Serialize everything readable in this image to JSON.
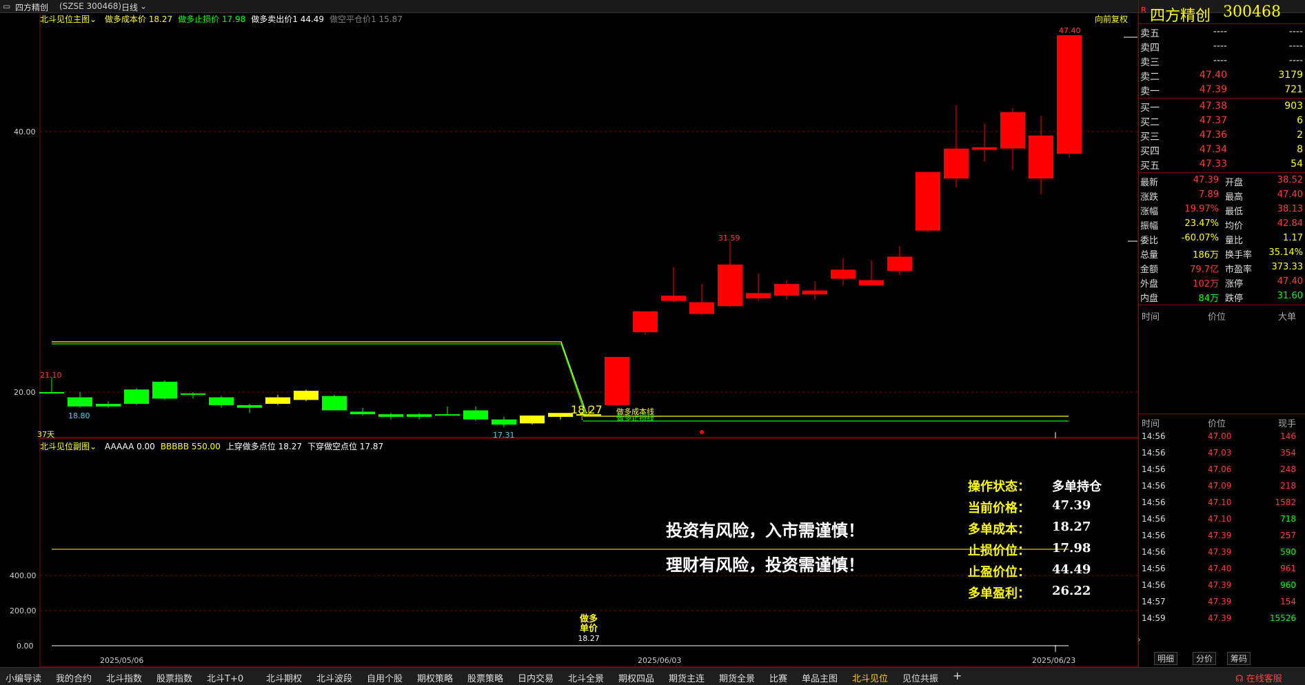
{
  "window": {
    "title": "四方精创",
    "code": "(SZSE 300468)",
    "period": "日线"
  },
  "main_indicator": {
    "name": "北斗见位主图",
    "items": [
      {
        "label": "做多成本价",
        "value": "18.27",
        "color": "#ffff00"
      },
      {
        "label": "做多止损价",
        "value": "17.98",
        "color": "#00ff00"
      },
      {
        "label": "做多卖出价1",
        "value": "44.49",
        "color": "#ffffff"
      },
      {
        "label": "做空平仓价1",
        "value": "15.87",
        "color": "#808080"
      }
    ],
    "restore_label": "向前复权",
    "period_label": "37天"
  },
  "sub_indicator": {
    "name": "北斗见位副图",
    "items": [
      {
        "label": "AAAAA",
        "value": "0.00",
        "color": "#ffffff"
      },
      {
        "label": "BBBBB",
        "value": "550.00",
        "color": "#ffff00"
      },
      {
        "label": "上穿做多点位",
        "value": "18.27",
        "color": "#ffffff"
      },
      {
        "label": "下穿做空点位",
        "value": "17.87",
        "color": "#ffffff"
      }
    ],
    "y_ticks": [
      "400.00",
      "200.00",
      "0.00"
    ],
    "marker": {
      "line1": "做多",
      "line2": "单价",
      "value": "18.27"
    }
  },
  "chart_data": {
    "type": "candlestick",
    "y_ticks": [
      "40.00",
      "20.00"
    ],
    "x_labels": [
      "2025/05/06",
      "2025/06/03",
      "2025/06/23"
    ],
    "annotations": {
      "high_label": "47.40",
      "mid_high": "31.59",
      "start_high": "21.10",
      "low1": "18.80",
      "low2": "17.31",
      "buy_price": "18.27",
      "buy_text": "做多成本线",
      "stop_text": "做多止损线"
    },
    "candles": [
      {
        "o": 20.0,
        "h": 21.1,
        "l": 19.9,
        "c": 20.0
      },
      {
        "o": 19.6,
        "h": 20.0,
        "l": 18.8,
        "c": 18.9
      },
      {
        "o": 19.1,
        "h": 19.3,
        "l": 18.8,
        "c": 18.9
      },
      {
        "o": 19.1,
        "h": 20.3,
        "l": 19.0,
        "c": 20.2
      },
      {
        "o": 19.5,
        "h": 20.9,
        "l": 19.4,
        "c": 20.8
      },
      {
        "o": 19.9,
        "h": 20.0,
        "l": 19.5,
        "c": 19.8
      },
      {
        "o": 19.6,
        "h": 19.7,
        "l": 18.8,
        "c": 19.0
      },
      {
        "o": 19.0,
        "h": 19.1,
        "l": 18.4,
        "c": 18.8
      },
      {
        "o": 19.1,
        "h": 19.8,
        "l": 19.0,
        "c": 19.6
      },
      {
        "o": 19.4,
        "h": 20.2,
        "l": 19.3,
        "c": 20.1
      },
      {
        "o": 19.7,
        "h": 19.8,
        "l": 18.6,
        "c": 18.6
      },
      {
        "o": 18.5,
        "h": 18.8,
        "l": 18.2,
        "c": 18.3
      },
      {
        "o": 18.3,
        "h": 18.4,
        "l": 17.9,
        "c": 18.1
      },
      {
        "o": 18.1,
        "h": 18.4,
        "l": 17.9,
        "c": 18.3
      },
      {
        "o": 18.3,
        "h": 18.9,
        "l": 18.2,
        "c": 18.3
      },
      {
        "o": 18.6,
        "h": 18.9,
        "l": 17.8,
        "c": 17.9
      },
      {
        "o": 17.9,
        "h": 18.1,
        "l": 17.31,
        "c": 17.5
      },
      {
        "o": 17.6,
        "h": 18.2,
        "l": 17.5,
        "c": 18.2
      },
      {
        "o": 18.1,
        "h": 18.4,
        "l": 17.9,
        "c": 18.4
      },
      {
        "o": 18.3,
        "h": 18.9,
        "l": 18.2,
        "c": 18.3
      },
      {
        "o": 19.0,
        "h": 22.7,
        "l": 18.9,
        "c": 22.7
      },
      {
        "o": 24.6,
        "h": 26.2,
        "l": 24.4,
        "c": 26.2
      },
      {
        "o": 27.0,
        "h": 29.6,
        "l": 26.9,
        "c": 27.4
      },
      {
        "o": 26.0,
        "h": 28.3,
        "l": 25.9,
        "c": 26.9
      },
      {
        "o": 26.6,
        "h": 31.59,
        "l": 26.5,
        "c": 29.8
      },
      {
        "o": 27.2,
        "h": 29.1,
        "l": 27.0,
        "c": 27.6
      },
      {
        "o": 27.4,
        "h": 28.6,
        "l": 27.1,
        "c": 28.3
      },
      {
        "o": 27.5,
        "h": 28.5,
        "l": 27.1,
        "c": 27.8
      },
      {
        "o": 28.7,
        "h": 30.3,
        "l": 28.2,
        "c": 29.4
      },
      {
        "o": 28.2,
        "h": 30.1,
        "l": 28.2,
        "c": 28.6
      },
      {
        "o": 29.3,
        "h": 31.2,
        "l": 29.0,
        "c": 30.4
      },
      {
        "o": 32.4,
        "h": 36.9,
        "l": 32.3,
        "c": 36.9
      },
      {
        "o": 36.4,
        "h": 42.0,
        "l": 35.7,
        "c": 38.7
      },
      {
        "o": 38.6,
        "h": 40.6,
        "l": 37.7,
        "c": 38.8
      },
      {
        "o": 38.7,
        "h": 41.8,
        "l": 37.1,
        "c": 41.5
      },
      {
        "o": 36.4,
        "h": 41.2,
        "l": 35.2,
        "c": 39.7
      },
      {
        "o": 38.3,
        "h": 47.4,
        "l": 38.0,
        "c": 47.4
      }
    ]
  },
  "overlay": {
    "risk1": "投资有风险，入市需谨慎！",
    "risk2": "理财有风险，投资需谨慎！",
    "rows": [
      {
        "label": "操作状态：",
        "value": "多单持仓"
      },
      {
        "label": "当前价格：",
        "value": "47.39"
      },
      {
        "label": "多单成本：",
        "value": "18.27"
      },
      {
        "label": "止损价位：",
        "value": "17.98"
      },
      {
        "label": "止盈价位：",
        "value": "44.49"
      },
      {
        "label": "多单盈利：",
        "value": "26.22"
      }
    ]
  },
  "quote": {
    "name": "四方精创",
    "code": "300468",
    "asks": [
      {
        "label": "卖五",
        "price": "----",
        "vol": "----"
      },
      {
        "label": "卖四",
        "price": "----",
        "vol": "----"
      },
      {
        "label": "卖三",
        "price": "----",
        "vol": "----"
      },
      {
        "label": "卖二",
        "price": "47.40",
        "vol": "3179"
      },
      {
        "label": "卖一",
        "price": "47.39",
        "vol": "721"
      }
    ],
    "bids": [
      {
        "label": "买一",
        "price": "47.38",
        "vol": "903"
      },
      {
        "label": "买二",
        "price": "47.37",
        "vol": "6"
      },
      {
        "label": "买三",
        "price": "47.36",
        "vol": "2"
      },
      {
        "label": "买四",
        "price": "47.34",
        "vol": "8"
      },
      {
        "label": "买五",
        "price": "47.33",
        "vol": "54"
      }
    ],
    "stats": [
      {
        "l1": "最新",
        "v1": "47.39",
        "c1": "#ff3b3b",
        "l2": "开盘",
        "v2": "38.52",
        "c2": "#ff3b3b"
      },
      {
        "l1": "涨跌",
        "v1": "7.89",
        "c1": "#ff3b3b",
        "l2": "最高",
        "v2": "47.40",
        "c2": "#ff3b3b"
      },
      {
        "l1": "涨幅",
        "v1": "19.97%",
        "c1": "#ff3b3b",
        "l2": "最低",
        "v2": "38.13",
        "c2": "#ff3b3b"
      },
      {
        "l1": "振幅",
        "v1": "23.47%",
        "c1": "#ffff00",
        "l2": "均价",
        "v2": "42.84",
        "c2": "#ff3b3b"
      },
      {
        "l1": "委比",
        "v1": "-60.07%",
        "c1": "#ffff00",
        "l2": "量比",
        "v2": "1.17",
        "c2": "#ffff00"
      },
      {
        "l1": "总量",
        "v1": "186万",
        "c1": "#ffff00",
        "l2": "换手率",
        "v2": "35.14%",
        "c2": "#ffff00"
      },
      {
        "l1": "金额",
        "v1": "79.7亿",
        "c1": "#ff3b3b",
        "l2": "市盈率",
        "v2": "373.33",
        "c2": "#ffff00"
      },
      {
        "l1": "外盘",
        "v1": "102万",
        "c1": "#ff3b3b",
        "l2": "涨停",
        "v2": "47.40",
        "c2": "#ff3b3b"
      },
      {
        "l1": "内盘",
        "v1": "84万",
        "c1": "#00ff00",
        "l2": "跌停",
        "v2": "31.60",
        "c2": "#00ff00"
      }
    ],
    "bigorder_header": [
      "时间",
      "价位",
      "大单"
    ],
    "trades_header": [
      "时间",
      "价位",
      "现手"
    ],
    "trades": [
      {
        "t": "14:56",
        "p": "47.00",
        "v": "146",
        "c": "#ff3b3b"
      },
      {
        "t": "14:56",
        "p": "47.03",
        "v": "354",
        "c": "#ff3b3b"
      },
      {
        "t": "14:56",
        "p": "47.06",
        "v": "248",
        "c": "#ff3b3b"
      },
      {
        "t": "14:56",
        "p": "47.09",
        "v": "218",
        "c": "#ff3b3b"
      },
      {
        "t": "14:56",
        "p": "47.10",
        "v": "1582",
        "c": "#ff3b3b"
      },
      {
        "t": "14:56",
        "p": "47.10",
        "v": "718",
        "c": "#00ff00"
      },
      {
        "t": "14:56",
        "p": "47.39",
        "v": "257",
        "c": "#ff3b3b"
      },
      {
        "t": "14:56",
        "p": "47.39",
        "v": "590",
        "c": "#00ff00"
      },
      {
        "t": "14:56",
        "p": "47.40",
        "v": "961",
        "c": "#ff3b3b"
      },
      {
        "t": "14:56",
        "p": "47.39",
        "v": "960",
        "c": "#00ff00"
      },
      {
        "t": "14:57",
        "p": "47.39",
        "v": "154",
        "c": "#ff3b3b"
      },
      {
        "t": "14:59",
        "p": "47.39",
        "v": "15526",
        "c": "#00ff00"
      }
    ],
    "side_tabs": [
      "明细",
      "分价",
      "筹码"
    ]
  },
  "bottom_tabs": [
    "小编导读",
    "我的合约",
    "北斗指数",
    "股票指数",
    "北斗T+0",
    "北斗期权",
    "北斗波段",
    "自用个股",
    "期权策略",
    "股票策略",
    "日内交易",
    "北斗全景",
    "期权四品",
    "期货主连",
    "期货全景",
    "比赛",
    "单品主图",
    "北斗见位",
    "见位共振",
    "+"
  ],
  "active_tab": "北斗见位",
  "service_label": "在线客服"
}
